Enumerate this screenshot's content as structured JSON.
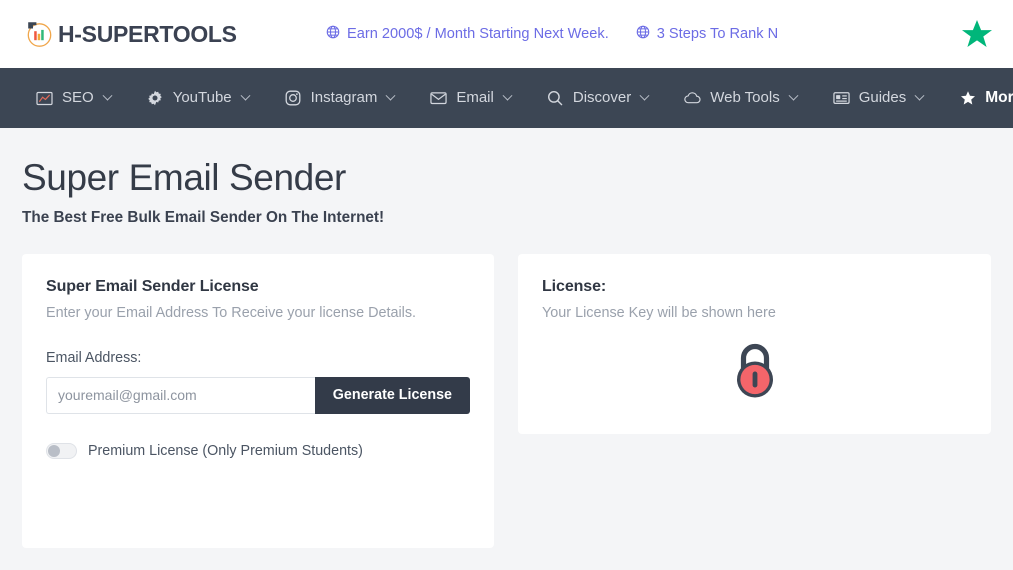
{
  "header": {
    "brand": "H-SUPERTOOLS",
    "brand_icon": "bar-chart-circle-logo",
    "promo_links": [
      {
        "icon": "globe-icon",
        "label": "Earn 2000$ / Month Starting Next Week."
      },
      {
        "icon": "globe-icon",
        "label": "3 Steps To Rank N"
      }
    ],
    "trust_icon": "trustpilot-star-icon",
    "colors": {
      "promo_link": "#6c6ce5",
      "trust_star": "#00b67a"
    }
  },
  "nav": {
    "background": "#3c4654",
    "items": [
      {
        "icon": "chart-line-icon",
        "label": "SEO",
        "caret": true,
        "emphasis": false
      },
      {
        "icon": "gear-icon",
        "label": "YouTube",
        "caret": true,
        "emphasis": false
      },
      {
        "icon": "instagram-icon",
        "label": "Instagram",
        "caret": true,
        "emphasis": false
      },
      {
        "icon": "envelope-icon",
        "label": "Email",
        "caret": true,
        "emphasis": false
      },
      {
        "icon": "search-icon",
        "label": "Discover",
        "caret": true,
        "emphasis": false
      },
      {
        "icon": "cloud-icon",
        "label": "Web Tools",
        "caret": true,
        "emphasis": false
      },
      {
        "icon": "id-card-icon",
        "label": "Guides",
        "caret": true,
        "emphasis": false
      },
      {
        "icon": "star-icon",
        "label": "More!",
        "caret": true,
        "emphasis": true
      }
    ]
  },
  "page": {
    "title": "Super Email Sender",
    "subtitle": "The Best Free Bulk Email Sender On The Internet!"
  },
  "license_form": {
    "title": "Super Email Sender License",
    "description": "Enter your Email Address To Receive your license Details.",
    "email_label": "Email Address:",
    "email_value": "",
    "email_placeholder": "youremail@gmail.com",
    "generate_button": "Generate License",
    "premium_toggle": {
      "label": "Premium License (Only Premium Students)",
      "state": "off"
    }
  },
  "license_output": {
    "title": "License:",
    "placeholder_text": "Your License Key will be shown here",
    "icon": "padlock-icon",
    "icon_colors": {
      "body": "#f4656a",
      "shackle": "#3d4654",
      "keyhole": "#3d4654"
    }
  }
}
